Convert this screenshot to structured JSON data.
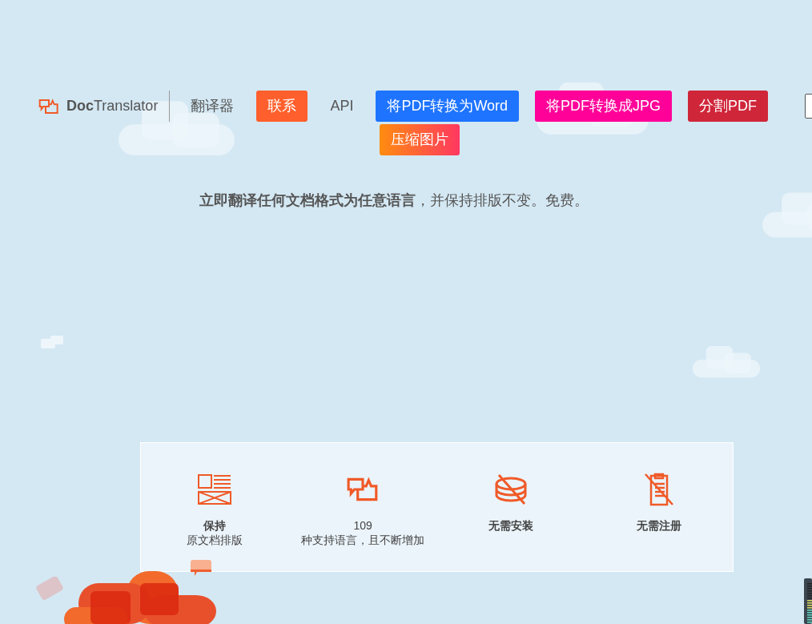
{
  "brand": {
    "name_bold": "Doc",
    "name_rest": "Translator"
  },
  "nav_rows": [
    [
      {
        "label": "翻译器",
        "kind": "plain"
      },
      {
        "label": "联系",
        "kind": "solid",
        "color": "#ff5f2c"
      },
      {
        "label": "API",
        "kind": "plain"
      },
      {
        "label": "将PDF转换为Word",
        "kind": "solid",
        "color": "#1e74ff"
      },
      {
        "label": "将PDF转换成JPG",
        "kind": "solid",
        "color": "#ff0099"
      },
      {
        "label": "分割PDF",
        "kind": "solid",
        "color": "#d0263a"
      }
    ],
    [
      {
        "label": "压缩图片",
        "kind": "gradient",
        "color": "#ff8c10"
      }
    ]
  ],
  "tagline": "**立即翻译任何文档格式为任意语言**，并保持排版不变。免费。",
  "features": [
    {
      "lines": [
        {
          "text": "保持",
          "bold": true
        },
        {
          "text": "原文档排版",
          "bold": false
        }
      ]
    },
    {
      "lines": [
        {
          "text": "109",
          "bold": false
        },
        {
          "text": "种支持语言，且不断增加",
          "bold": false
        }
      ]
    },
    {
      "lines": [
        {
          "text": "无需安装",
          "bold": true
        }
      ]
    },
    {
      "lines": [
        {
          "text": "无需注册",
          "bold": true
        }
      ]
    }
  ]
}
